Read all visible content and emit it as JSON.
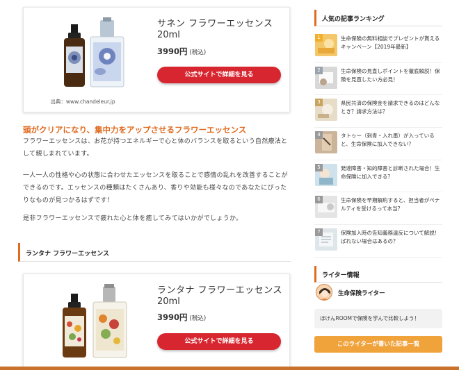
{
  "products": [
    {
      "name": "サネン フラワーエッセンス",
      "size": "20ml",
      "price": "3990円",
      "tax": "(税込)",
      "button": "公式サイトで詳細を見る",
      "credit": "出典：www.chandeleur.jp"
    },
    {
      "name": "ランタナ フラワーエッセンス",
      "size": "20ml",
      "price": "3990円",
      "tax": "(税込)",
      "button": "公式サイトで詳細を見る"
    }
  ],
  "article": {
    "subheading": "頭がクリアになり、集中力をアップさせるフラワーエッセンス",
    "paragraph1": "フラワーエッセンスは、お花が持つエネルギーで心と体のバランスを取るという自然療法として親しまれています。",
    "paragraph2": "一人一人の性格や心の状態に合わせたエッセンスを取ることで感情の乱れを改善することができるのです。エッセンスの種類はたくさんあり、香りや効能も様々なのであなたにぴったりなものが見つかるはずです！",
    "paragraph3": "是非フラワーエッセンスで疲れた心と体を癒してみてはいかがでしょうか。",
    "section_heading": "ランタナ フラワーエッセンス"
  },
  "sidebar": {
    "ranking_title": "人気の記事ランキング",
    "ranking": [
      {
        "rank": "1",
        "title": "生命保険の無料相談でプレゼントが貰えるキャンペーン【2019年最新】",
        "color": "#f0b02b"
      },
      {
        "rank": "2",
        "title": "生命保険の見直しポイントを徹底解説！保険を見直したい方必見！",
        "color": "#9aa3ad"
      },
      {
        "rank": "3",
        "title": "県民共済の保険金を請求できるのはどんなとき？請求方法は？",
        "color": "#c9a35c"
      },
      {
        "rank": "4",
        "title": "タトゥー（刺青・入れ墨）が入っていると、生命保険に加入できない？",
        "color": "#999999"
      },
      {
        "rank": "5",
        "title": "発達障害・知的障害と診断された場合！生命保険に加入できる？",
        "color": "#999999"
      },
      {
        "rank": "6",
        "title": "生命保険を早期解約すると、担当者がペナルティを受けるって本当？",
        "color": "#999999"
      },
      {
        "rank": "7",
        "title": "保険加入時の告知義務違反について解説！ばれない場合はあるの？",
        "color": "#999999"
      }
    ],
    "writer_title": "ライター情報",
    "writer_name": "生命保険ライター",
    "writer_bio": "ほけんROOMで保険を学んで比較しよう！",
    "writer_button": "このライターが書いた記事一覧"
  }
}
